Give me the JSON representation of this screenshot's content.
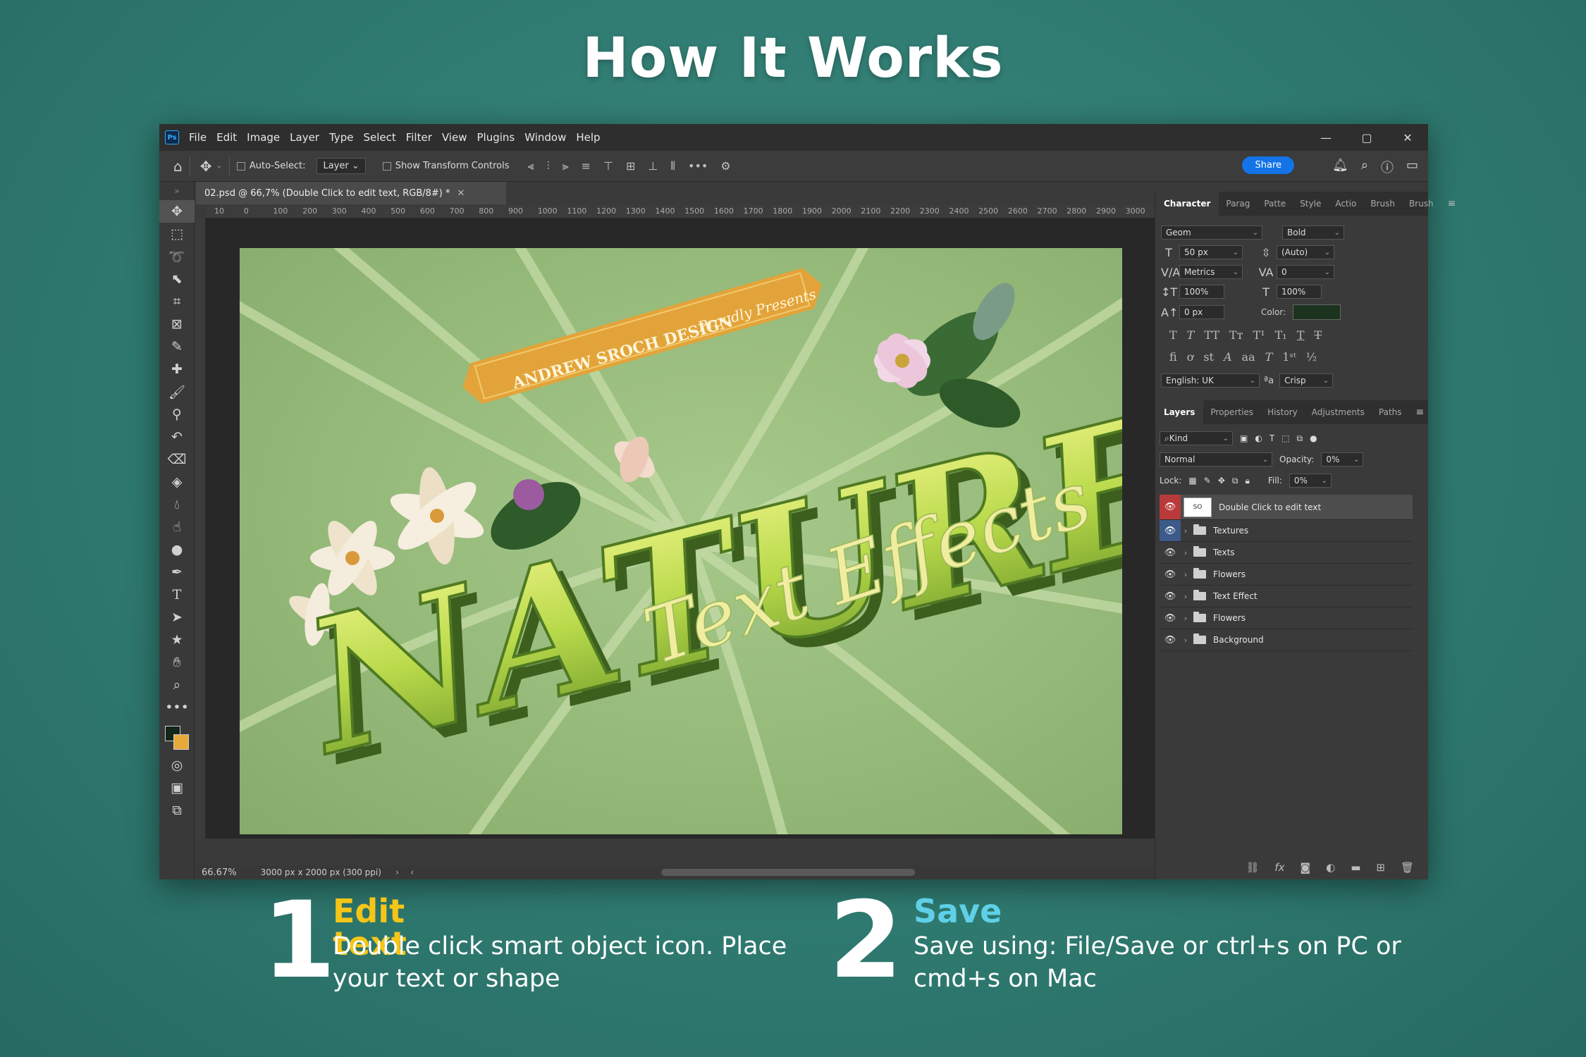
{
  "page": {
    "heading": "How It Works"
  },
  "app": {
    "logo": "Ps",
    "menu": [
      "File",
      "Edit",
      "Image",
      "Layer",
      "Type",
      "Select",
      "Filter",
      "View",
      "Plugins",
      "Window",
      "Help"
    ],
    "window_controls": [
      "—",
      "▢",
      "✕"
    ]
  },
  "options_bar": {
    "auto_select_label": "Auto-Select:",
    "auto_select_value": "Layer",
    "transform_label": "Show Transform Controls",
    "share_label": "Share"
  },
  "document": {
    "tab_title": "02.psd @ 66,7% (Double Click to edit text, RGB/8#) *",
    "ruler_marks": [
      "10",
      "0",
      "100",
      "200",
      "300",
      "400",
      "500",
      "600",
      "700",
      "800",
      "900",
      "1000",
      "1100",
      "1200",
      "1300",
      "1400",
      "1500",
      "1600",
      "1700",
      "1800",
      "1900",
      "2000",
      "2100",
      "2200",
      "2300",
      "2400",
      "2500",
      "2600",
      "2700",
      "2800",
      "2900",
      "3000"
    ],
    "zoom": "66.67%",
    "doc_info": "3000 px x 2000 px (300 ppi)"
  },
  "artwork": {
    "banner_text": "ANDREW SROCH DESIGN",
    "banner_script": "Proudly Presents",
    "main_word": "NATURE",
    "subtitle": "Text Effects"
  },
  "character_panel": {
    "tabs": [
      "Character",
      "Parag",
      "Patte",
      "Style",
      "Actio",
      "Brush",
      "Brush"
    ],
    "font_family": "Geom",
    "font_style": "Bold",
    "font_size": "50 px",
    "leading": "(Auto)",
    "kerning": "Metrics",
    "tracking": "0",
    "vertical_scale": "100%",
    "horizontal_scale": "100%",
    "baseline_shift": "0 px",
    "color_label": "Color:",
    "language": "English: UK",
    "antialias": "Crisp",
    "aa_label": "ªa",
    "color_value": "#1c3320"
  },
  "layers_panel": {
    "tabs": [
      "Layers",
      "Properties",
      "History",
      "Adjustments",
      "Paths"
    ],
    "filter_kind": "Kind",
    "blend_mode": "Normal",
    "opacity_label": "Opacity:",
    "opacity_value": "0%",
    "lock_label": "Lock:",
    "fill_label": "Fill:",
    "fill_value": "0%",
    "layers": [
      {
        "name": "Double Click to edit text",
        "kind": "smart-object"
      },
      {
        "name": "Textures",
        "kind": "group"
      },
      {
        "name": "Texts",
        "kind": "group"
      },
      {
        "name": "Flowers",
        "kind": "group"
      },
      {
        "name": "Text Effect",
        "kind": "group"
      },
      {
        "name": "Flowers",
        "kind": "group"
      },
      {
        "name": "Background",
        "kind": "group"
      }
    ]
  },
  "steps": [
    {
      "number": "1",
      "title": "Edit text",
      "description": "Double click smart object icon. Place your text or shape",
      "color": "#f5c518"
    },
    {
      "number": "2",
      "title": "Save",
      "description": "Save using: File/Save or ctrl+s on PC or cmd+s on Mac",
      "color": "#5fd0e8"
    }
  ]
}
